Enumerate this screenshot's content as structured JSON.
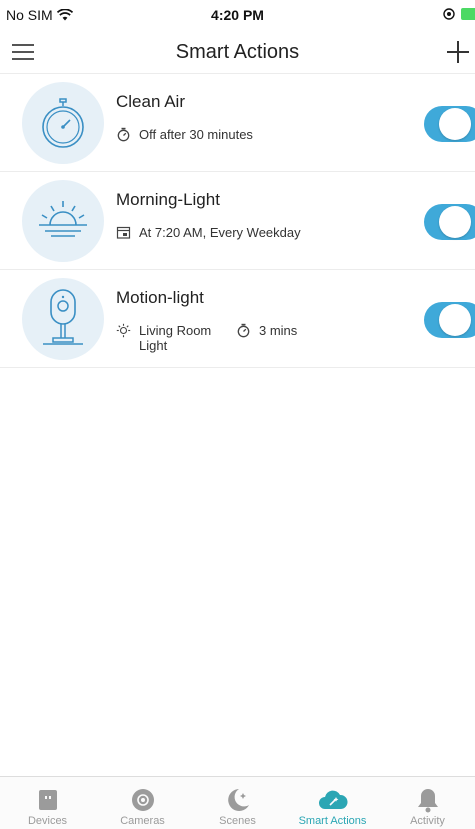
{
  "status_bar": {
    "carrier": "No SIM",
    "time": "4:20 PM"
  },
  "header": {
    "title": "Smart Actions"
  },
  "actions": [
    {
      "name": "Clean Air",
      "icon": "timer-device-icon",
      "details": [
        {
          "icon": "timer-icon",
          "text": "Off after 30 minutes"
        }
      ],
      "enabled": true
    },
    {
      "name": "Morning-Light",
      "icon": "sunrise-icon",
      "details": [
        {
          "icon": "calendar-icon",
          "text": "At 7:20 AM, Every Weekday"
        }
      ],
      "enabled": true
    },
    {
      "name": "Motion-light",
      "icon": "camera-icon",
      "details": [
        {
          "icon": "bulb-icon",
          "text": "Living Room Light"
        },
        {
          "icon": "timer-icon",
          "text": "3 mins"
        }
      ],
      "enabled": true
    }
  ],
  "tabs": [
    {
      "label": "Devices",
      "icon": "devices-icon",
      "active": false
    },
    {
      "label": "Cameras",
      "icon": "cameras-icon",
      "active": false
    },
    {
      "label": "Scenes",
      "icon": "scenes-icon",
      "active": false
    },
    {
      "label": "Smart Actions",
      "icon": "smart-actions-icon",
      "active": true
    },
    {
      "label": "Activity",
      "icon": "activity-icon",
      "active": false
    }
  ],
  "colors": {
    "accent": "#3fa9d9",
    "active_tab": "#2ba6b4",
    "icon_bg": "#e6f0f7"
  }
}
